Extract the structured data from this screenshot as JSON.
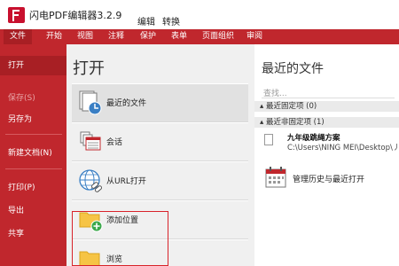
{
  "app": {
    "title": "闪电PDF编辑器3.2.9"
  },
  "title_menu": {
    "edit": "编辑",
    "convert": "转换"
  },
  "tabs": [
    "文件",
    "开始",
    "视图",
    "注释",
    "保护",
    "表单",
    "页面组织",
    "审阅"
  ],
  "sidebar": {
    "items": [
      "打开",
      "保存(S)",
      "另存为",
      "新建文档(N)",
      "打印(P)",
      "导出",
      "共享"
    ]
  },
  "open_panel": {
    "title": "打开",
    "items": [
      "最近的文件",
      "会话",
      "从URL打开",
      "添加位置",
      "浏览"
    ]
  },
  "recent_panel": {
    "title": "最近的文件",
    "search_placeholder": "查找...",
    "pinned_group": "最近固定项 (0)",
    "unpinned_group": "最近非固定项 (1)",
    "file": {
      "name": "九年级跳绳方案",
      "path": "C:\\Users\\NING MEI\\Desktop\\丿"
    },
    "manage_label": "管理历史与最近打开"
  },
  "colors": {
    "accent": "#c0272d",
    "accent_dark": "#a81f24",
    "highlight": "#d8232a"
  }
}
